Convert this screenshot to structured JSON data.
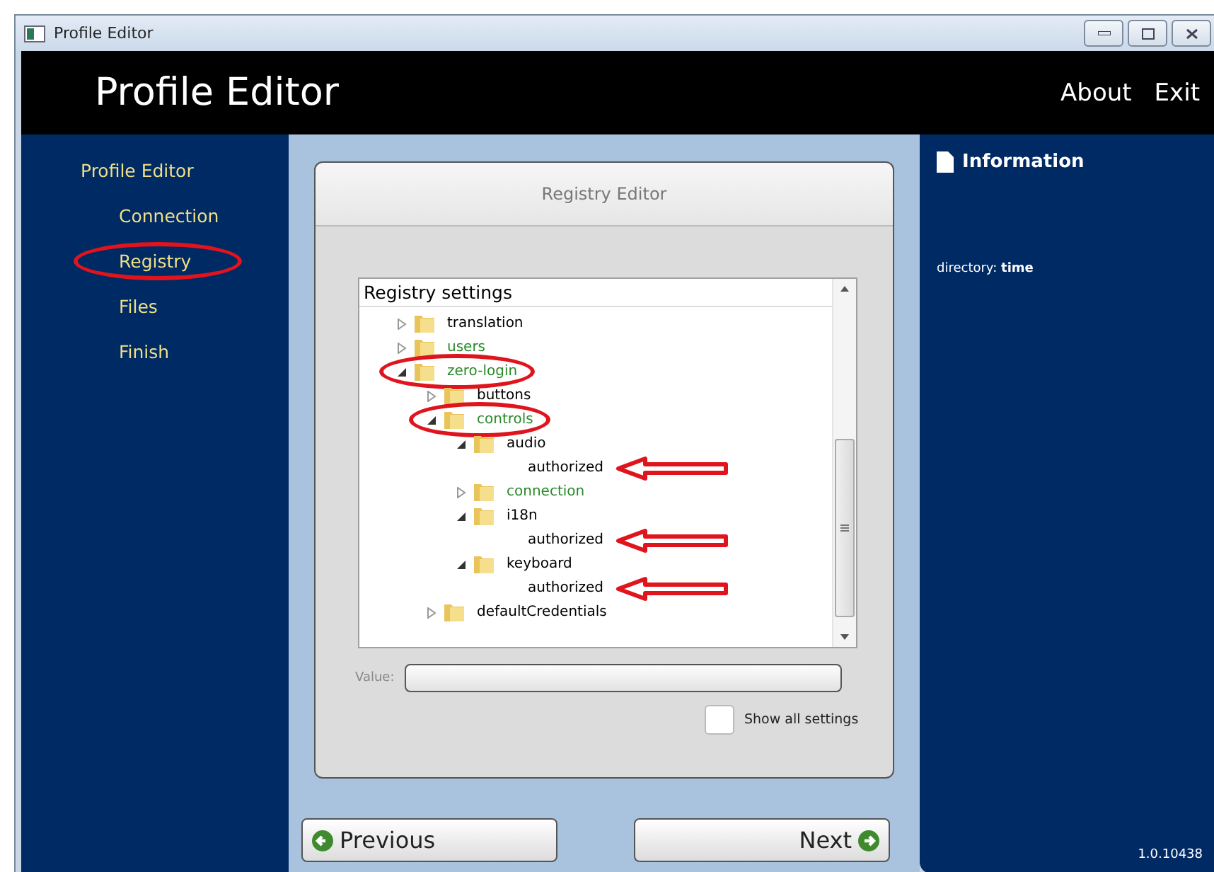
{
  "window": {
    "title": "Profile Editor"
  },
  "header": {
    "title": "Profile Editor",
    "links": [
      "About",
      "Exit"
    ]
  },
  "sidebar": {
    "heading": "Profile Editor",
    "items": [
      {
        "label": "Connection",
        "highlighted": false
      },
      {
        "label": "Registry",
        "highlighted": true
      },
      {
        "label": "Files",
        "highlighted": false
      },
      {
        "label": "Finish",
        "highlighted": false
      }
    ]
  },
  "editor": {
    "title": "Registry Editor",
    "tree_heading": "Registry settings",
    "tree": [
      {
        "kind": "folder",
        "label": "translation",
        "expanded": false,
        "color": "#000000",
        "highlighted": false
      },
      {
        "kind": "folder",
        "label": "users",
        "expanded": false,
        "color": "#2a8a2a",
        "highlighted": false
      },
      {
        "kind": "folder",
        "label": "zero-login",
        "expanded": true,
        "color": "#2a8a2a",
        "highlighted": true,
        "children": [
          {
            "kind": "folder",
            "label": "buttons",
            "expanded": false,
            "color": "#000000",
            "highlighted": false
          },
          {
            "kind": "folder",
            "label": "controls",
            "expanded": true,
            "color": "#2a8a2a",
            "highlighted": true,
            "children": [
              {
                "kind": "folder",
                "label": "audio",
                "expanded": true,
                "color": "#000000",
                "highlighted": false,
                "children": [
                  {
                    "kind": "value",
                    "label": "authorized",
                    "color": "#000000",
                    "arrow": true
                  }
                ]
              },
              {
                "kind": "folder",
                "label": "connection",
                "expanded": false,
                "color": "#2a8a2a",
                "highlighted": false
              },
              {
                "kind": "folder",
                "label": "i18n",
                "expanded": true,
                "color": "#000000",
                "highlighted": false,
                "children": [
                  {
                    "kind": "value",
                    "label": "authorized",
                    "color": "#000000",
                    "arrow": true
                  }
                ]
              },
              {
                "kind": "folder",
                "label": "keyboard",
                "expanded": true,
                "color": "#000000",
                "highlighted": false,
                "children": [
                  {
                    "kind": "value",
                    "label": "authorized",
                    "color": "#000000",
                    "arrow": true
                  }
                ]
              }
            ]
          },
          {
            "kind": "folder",
            "label": "defaultCredentials",
            "expanded": false,
            "color": "#000000",
            "highlighted": false
          }
        ]
      }
    ],
    "value_label": "Value:",
    "show_all": {
      "label": "Show all settings",
      "checked": false
    }
  },
  "buttons": {
    "previous": "Previous",
    "next": "Next"
  },
  "info": {
    "title": "Information",
    "text": "directory: **time**",
    "version": "1.0.10438"
  }
}
